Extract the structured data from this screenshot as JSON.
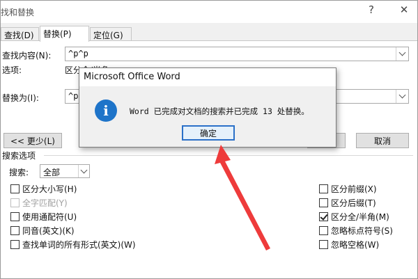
{
  "window": {
    "title": "找和替换",
    "help": "?",
    "close": "✕"
  },
  "tabs": [
    {
      "label": "查找(D)",
      "active": false
    },
    {
      "label": "替换(P)",
      "active": true
    },
    {
      "label": "定位(G)",
      "active": false
    }
  ],
  "find": {
    "label": "查找内容(N):",
    "value": "^p^p"
  },
  "options": {
    "label": "选项:",
    "value": "区分全/半角"
  },
  "replace": {
    "label": "替换为(I):",
    "value": "^p"
  },
  "buttons": {
    "less": "<< 更少(L)",
    "cancel": "取消"
  },
  "search_options": {
    "heading": "搜索选项",
    "search_label": "搜索:",
    "search_value": "全部",
    "left": [
      {
        "label": "区分大小写(H)",
        "checked": false,
        "disabled": false
      },
      {
        "label": "全字匹配(Y)",
        "checked": false,
        "disabled": true
      },
      {
        "label": "使用通配符(U)",
        "checked": false,
        "disabled": false
      },
      {
        "label": "同音(英文)(K)",
        "checked": false,
        "disabled": false
      },
      {
        "label": "查找单词的所有形式(英文)(W)",
        "checked": false,
        "disabled": false
      }
    ],
    "right": [
      {
        "label": "区分前缀(X)",
        "checked": false,
        "disabled": false
      },
      {
        "label": "区分后缀(T)",
        "checked": false,
        "disabled": false
      },
      {
        "label": "区分全/半角(M)",
        "checked": true,
        "disabled": false
      },
      {
        "label": "忽略标点符号(S)",
        "checked": false,
        "disabled": false
      },
      {
        "label": "忽略空格(W)",
        "checked": false,
        "disabled": false
      }
    ]
  },
  "message_box": {
    "title": "Microsoft Office Word",
    "icon": "info-icon",
    "text": "Word 已完成对文档的搜索并已完成 13 处替换。",
    "ok": "确定"
  },
  "colors": {
    "annotation_arrow": "#ee3b3b",
    "info_icon": "#1e74c9",
    "focus_border": "#2a70c8"
  }
}
